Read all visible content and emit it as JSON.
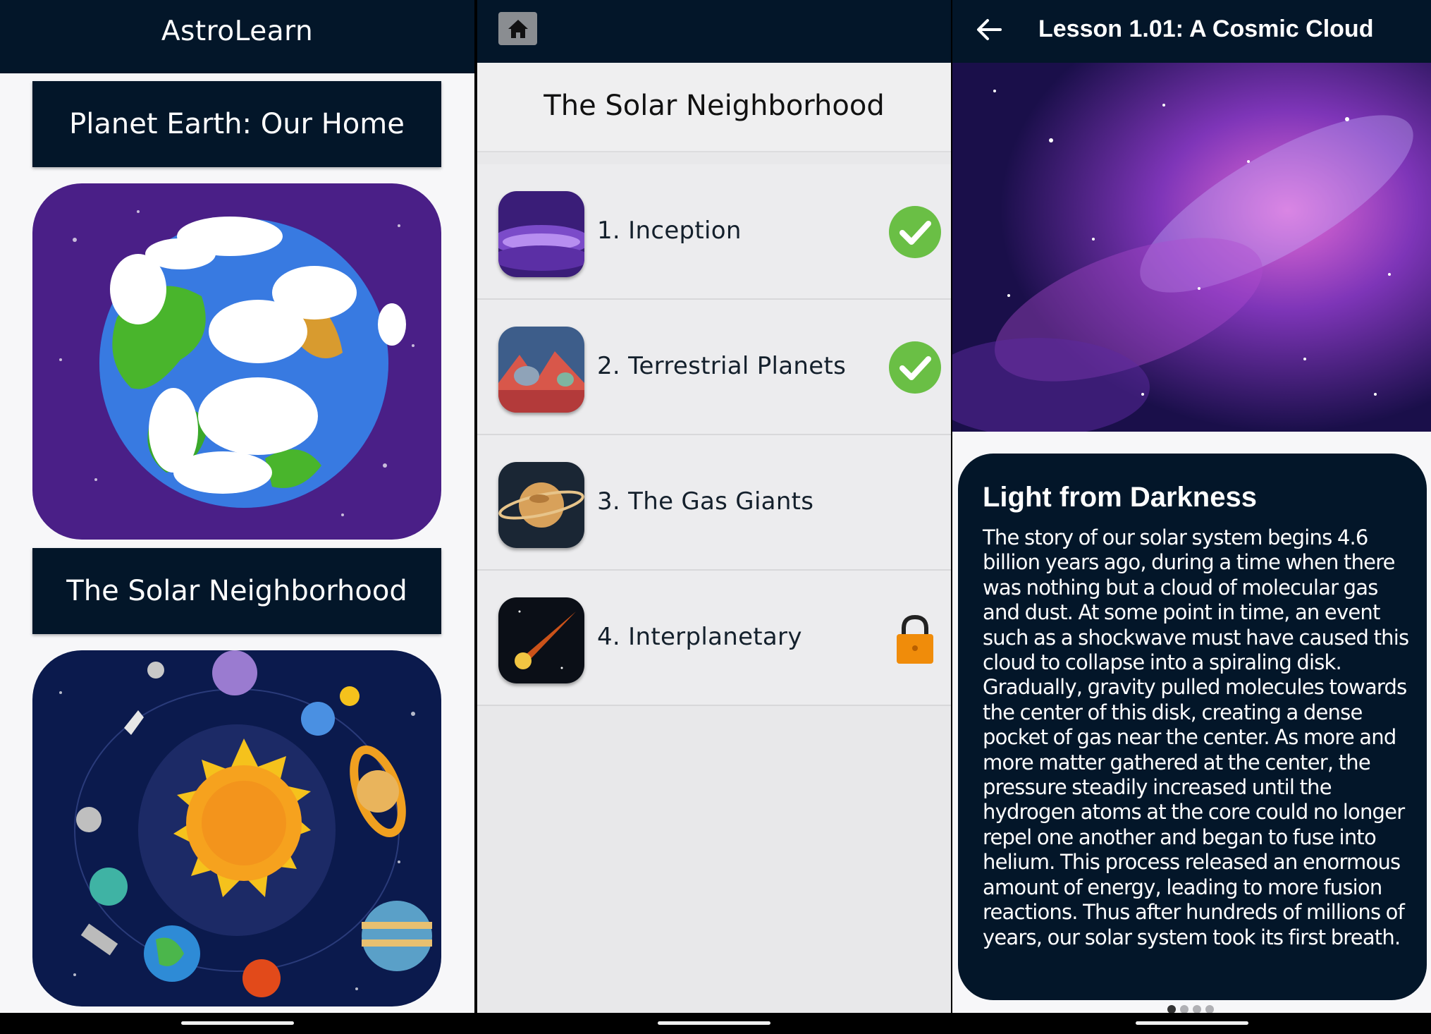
{
  "home": {
    "app_title": "AstroLearn",
    "sections": [
      {
        "label": "Planet Earth: Our Home"
      },
      {
        "label": "The Solar Neighborhood"
      }
    ]
  },
  "unit": {
    "header_title": "The Solar Neighborhood",
    "lessons": [
      {
        "label": "1. Inception",
        "status": "completed"
      },
      {
        "label": "2. Terrestrial Planets",
        "status": "completed"
      },
      {
        "label": "3. The Gas Giants",
        "status": "available"
      },
      {
        "label": "4. Interplanetary",
        "status": "locked"
      }
    ]
  },
  "lesson": {
    "title": "Lesson 1.01: A Cosmic Cloud",
    "heading": "Light from Darkness",
    "body": "The story of our solar system begins 4.6 billion years ago, during a time when there was nothing but a cloud of molecular gas and dust. At some point in time, an event such as a shockwave must have caused this cloud to collapse into a spiraling disk. Gradually, gravity pulled molecules towards the center of this disk, creating a dense pocket of gas near the center. As more and more matter gathered at the center, the pressure steadily increased until the hydrogen atoms at the core could no longer repel one another and began to fuse into helium. This process released an enormous amount of energy, leading to more fusion reactions. Thus after hundreds of millions of years, our solar system took its first breath.",
    "page_count": 4,
    "current_page": 1
  },
  "colors": {
    "navy": "#031629",
    "check_green": "#6abf45",
    "lock_orange": "#f08c0a"
  }
}
